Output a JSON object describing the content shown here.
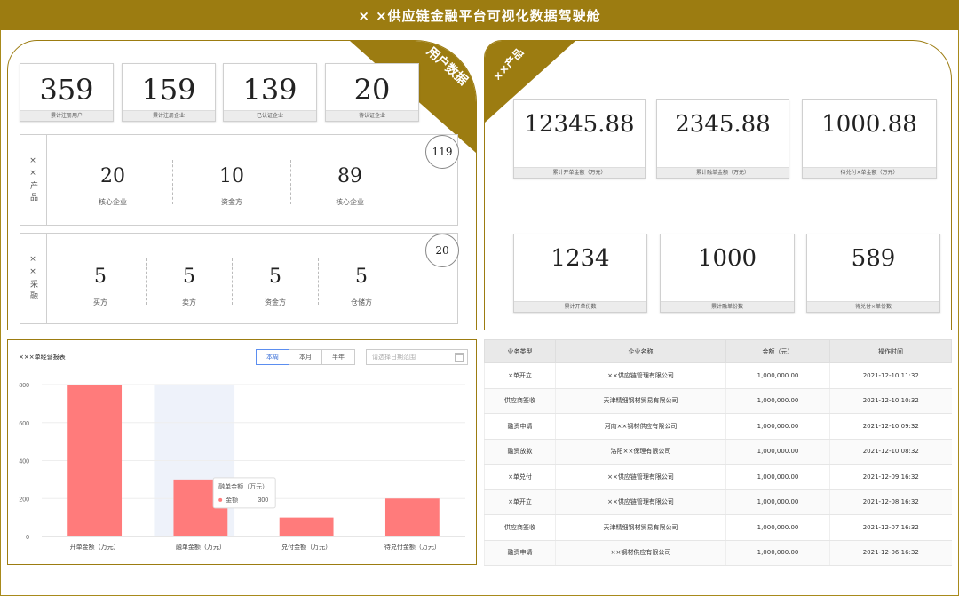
{
  "title": "× ×供应链金融平台可视化数据驾驶舱",
  "user_panel": {
    "label": "用户数据",
    "stats": [
      {
        "value": "359",
        "label": "累计注册用户"
      },
      {
        "value": "159",
        "label": "累计注册企业"
      },
      {
        "value": "139",
        "label": "已认证企业"
      },
      {
        "value": "20",
        "label": "待认证企业"
      }
    ],
    "product_group": {
      "side": "××产品",
      "badge": "119",
      "items": [
        {
          "value": "20",
          "label": "核心企业"
        },
        {
          "value": "10",
          "label": "资金方"
        },
        {
          "value": "89",
          "label": "核心企业"
        }
      ]
    },
    "finance_group": {
      "side": "××采融",
      "badge": "20",
      "items": [
        {
          "value": "5",
          "label": "买方"
        },
        {
          "value": "5",
          "label": "卖方"
        },
        {
          "value": "5",
          "label": "资金方"
        },
        {
          "value": "5",
          "label": "仓储方"
        }
      ]
    }
  },
  "product_panel": {
    "label": "××产品",
    "stats": [
      {
        "value": "12345.88",
        "label": "累计开单金额（万元）"
      },
      {
        "value": "2345.88",
        "label": "累计融单金额（万元）"
      },
      {
        "value": "1000.88",
        "label": "待兑付×单金额（万元）"
      },
      {
        "value": "1234",
        "label": "累计开单份数"
      },
      {
        "value": "1000",
        "label": "累计融单份数"
      },
      {
        "value": "589",
        "label": "待兑付×单份数"
      }
    ]
  },
  "chart_panel": {
    "title": "×××单经营报表",
    "periods": [
      "本周",
      "本月",
      "半年"
    ],
    "active_period": "本周",
    "date_placeholder": "请选择日期范围",
    "tooltip": {
      "title": "融单金额（万元）",
      "series": "金额",
      "value": "300"
    }
  },
  "chart_data": {
    "type": "bar",
    "categories": [
      "开单金额（万元）",
      "融单金额（万元）",
      "兑付金额（万元）",
      "待兑付金额（万元）"
    ],
    "values": [
      800,
      300,
      100,
      200
    ],
    "ylim": [
      0,
      800
    ],
    "yticks": [
      0,
      200,
      400,
      600,
      800
    ],
    "highlight_index": 1,
    "bar_color": "#ff7b7b",
    "highlight_color": "#eef2fa"
  },
  "table": {
    "headers": [
      "业务类型",
      "企业名称",
      "金额（元）",
      "操作时间"
    ],
    "rows": [
      [
        "×单开立",
        "××供应链管理有限公司",
        "1,000,000.00",
        "2021-12-10  11:32"
      ],
      [
        "供应商签收",
        "天津精细钢材贸易有限公司",
        "1,000,000.00",
        "2021-12-10  10:32"
      ],
      [
        "融资申请",
        "河南××钢材供应有限公司",
        "1,000,000.00",
        "2021-12-10  09:32"
      ],
      [
        "融资放款",
        "洛阳××保理有限公司",
        "1,000,000.00",
        "2021-12-10  08:32"
      ],
      [
        "×单兑付",
        "××供应链管理有限公司",
        "1,000,000.00",
        "2021-12-09  16:32"
      ],
      [
        "×单开立",
        "××供应链管理有限公司",
        "1,000,000.00",
        "2021-12-08  16:32"
      ],
      [
        "供应商签收",
        "天津精细钢材贸易有限公司",
        "1,000,000.00",
        "2021-12-07  16:32"
      ],
      [
        "融资申请",
        "××钢材供应有限公司",
        "1,000,000.00",
        "2021-12-06  16:32"
      ]
    ]
  }
}
